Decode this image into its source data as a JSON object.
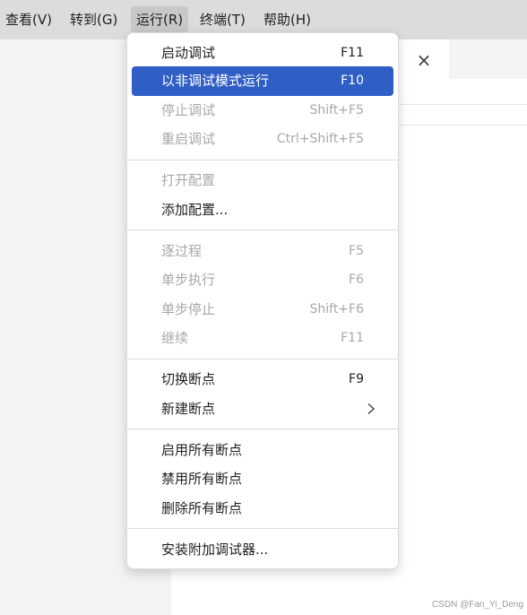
{
  "menubar": {
    "items": [
      {
        "label": "查看(V)"
      },
      {
        "label": "转到(G)"
      },
      {
        "label": "运行(R)"
      },
      {
        "label": "终端(T)"
      },
      {
        "label": "帮助(H)"
      }
    ]
  },
  "editor": {
    "close_icon": "×"
  },
  "run_menu": {
    "items": [
      {
        "label": "启动调试",
        "shortcut": "F11"
      },
      {
        "label": "以非调试模式运行",
        "shortcut": "F10"
      },
      {
        "label": "停止调试",
        "shortcut": "Shift+F5"
      },
      {
        "label": "重启调试",
        "shortcut": "Ctrl+Shift+F5"
      },
      {
        "label": "打开配置",
        "shortcut": ""
      },
      {
        "label": "添加配置...",
        "shortcut": ""
      },
      {
        "label": "逐过程",
        "shortcut": "F5"
      },
      {
        "label": "单步执行",
        "shortcut": "F6"
      },
      {
        "label": "单步停止",
        "shortcut": "Shift+F6"
      },
      {
        "label": "继续",
        "shortcut": "F11"
      },
      {
        "label": "切换断点",
        "shortcut": "F9"
      },
      {
        "label": "新建断点",
        "shortcut": ""
      },
      {
        "label": "启用所有断点",
        "shortcut": ""
      },
      {
        "label": "禁用所有断点",
        "shortcut": ""
      },
      {
        "label": "删除所有断点",
        "shortcut": ""
      },
      {
        "label": "安装附加调试器...",
        "shortcut": ""
      }
    ]
  },
  "colors": {
    "highlight": "#2f5ec4",
    "disabled_text": "#a8a8a8",
    "menubar_bg": "#dcdcdc"
  },
  "watermark": "CSDN @Fan_Yi_Deng"
}
